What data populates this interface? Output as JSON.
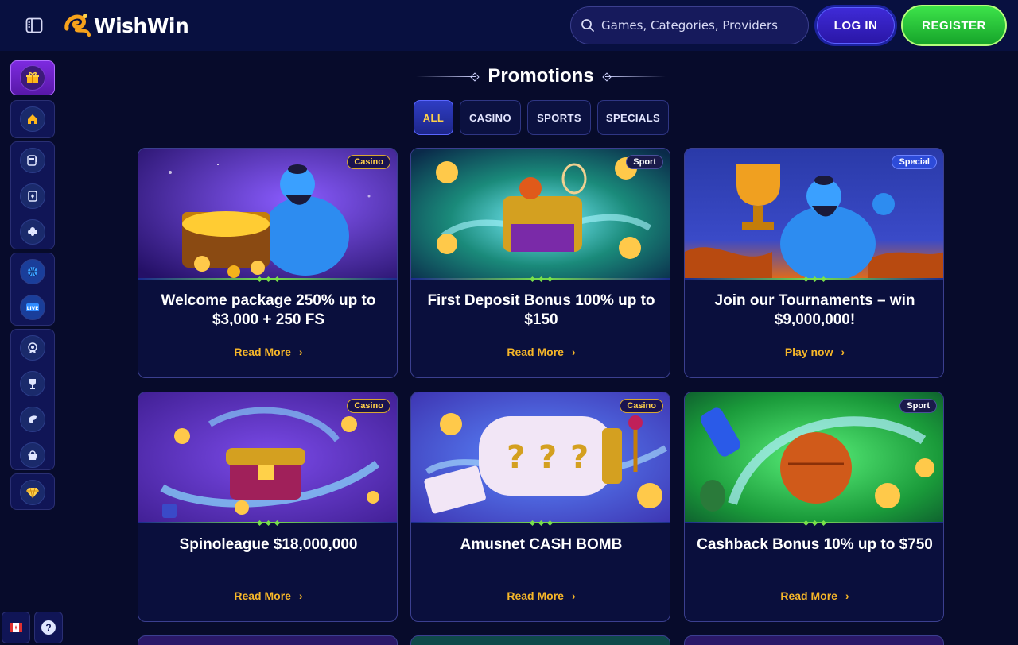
{
  "header": {
    "logo_text": "WishWin",
    "search_placeholder": "Games, Categories, Providers",
    "login_label": "LOG IN",
    "register_label": "REGISTER"
  },
  "sidebar": {
    "items": [
      {
        "icon": "gift-icon",
        "active": true
      },
      {
        "icon": "home-icon"
      },
      {
        "icon": "slot-machine-icon"
      },
      {
        "icon": "cards-icon"
      },
      {
        "icon": "clover-icon"
      },
      {
        "icon": "basketball-icon"
      },
      {
        "icon": "live-icon",
        "label": "LIVE"
      },
      {
        "icon": "medal-icon"
      },
      {
        "icon": "trophy-icon"
      },
      {
        "icon": "fast-icon"
      },
      {
        "icon": "shop-icon"
      },
      {
        "icon": "diamond-icon"
      }
    ],
    "bottom": [
      {
        "icon": "flag-icon"
      },
      {
        "icon": "help-icon"
      }
    ]
  },
  "page": {
    "title": "Promotions",
    "tabs": [
      {
        "label": "ALL",
        "active": true
      },
      {
        "label": "CASINO"
      },
      {
        "label": "SPORTS"
      },
      {
        "label": "SPECIALS"
      }
    ]
  },
  "cards": [
    {
      "badge": "Casino",
      "title": "Welcome package 250% up to $3,000 + 250 FS",
      "link": "Read More"
    },
    {
      "badge": "Sport",
      "title": "First Deposit Bonus 100% up to $150",
      "link": "Read More"
    },
    {
      "badge": "Special",
      "title": "Join our Tournaments – win $9,000,000!",
      "link": "Play now"
    },
    {
      "badge": "Casino",
      "title": "Spinoleague $18,000,000",
      "link": "Read More"
    },
    {
      "badge": "Casino",
      "title": "Amusnet CASH BOMB",
      "link": "Read More"
    },
    {
      "badge": "Sport",
      "title": "Cashback Bonus 10% up to $750",
      "link": "Read More"
    }
  ],
  "colors": {
    "accent_gold": "#f6b629",
    "register_green": "#2fcf3f",
    "login_blue": "#3420c8",
    "background": "#070b2b"
  }
}
